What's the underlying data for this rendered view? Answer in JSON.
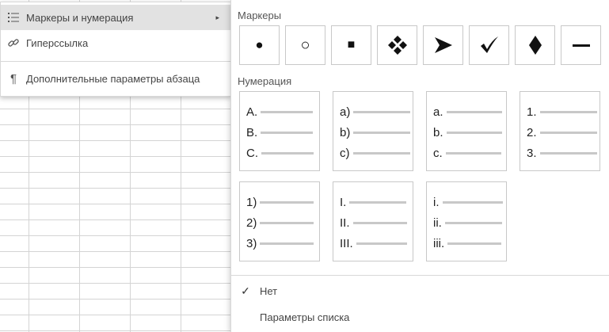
{
  "context_menu": {
    "items": [
      {
        "label": "Маркеры и нумерация",
        "icon": "list-icon",
        "has_submenu": true,
        "active": true
      },
      {
        "label": "Гиперссылка",
        "icon": "link-icon"
      },
      {
        "label": "Дополнительные параметры абзаца",
        "icon": "pilcrow-icon"
      }
    ]
  },
  "submenu": {
    "markers_title": "Маркеры",
    "markers": [
      {
        "name": "filled-circle",
        "glyph": "●"
      },
      {
        "name": "hollow-circle",
        "glyph": "○"
      },
      {
        "name": "filled-square",
        "glyph": "■"
      },
      {
        "name": "four-diamonds",
        "glyph": "❖"
      },
      {
        "name": "arrowhead",
        "glyph": "➤"
      },
      {
        "name": "checkmark",
        "glyph": "✓"
      },
      {
        "name": "diamond",
        "glyph": "◆"
      },
      {
        "name": "dash",
        "glyph": "—"
      }
    ],
    "numbering_title": "Нумерация",
    "numbering": [
      {
        "name": "upper-alpha-dot",
        "rows": [
          "A.",
          "B.",
          "C."
        ]
      },
      {
        "name": "lower-alpha-paren",
        "rows": [
          "a)",
          "b)",
          "c)"
        ]
      },
      {
        "name": "lower-alpha-dot",
        "rows": [
          "a.",
          "b.",
          "c."
        ]
      },
      {
        "name": "decimal-dot",
        "rows": [
          "1.",
          "2.",
          "3."
        ]
      },
      {
        "name": "decimal-paren",
        "rows": [
          "1)",
          "2)",
          "3)"
        ]
      },
      {
        "name": "upper-roman",
        "rows": [
          "I.",
          "II.",
          "III."
        ]
      },
      {
        "name": "lower-roman",
        "rows": [
          "i.",
          "ii.",
          "iii."
        ]
      }
    ],
    "none_label": "Нет",
    "none_checked": true,
    "list_settings_label": "Параметры списка"
  }
}
